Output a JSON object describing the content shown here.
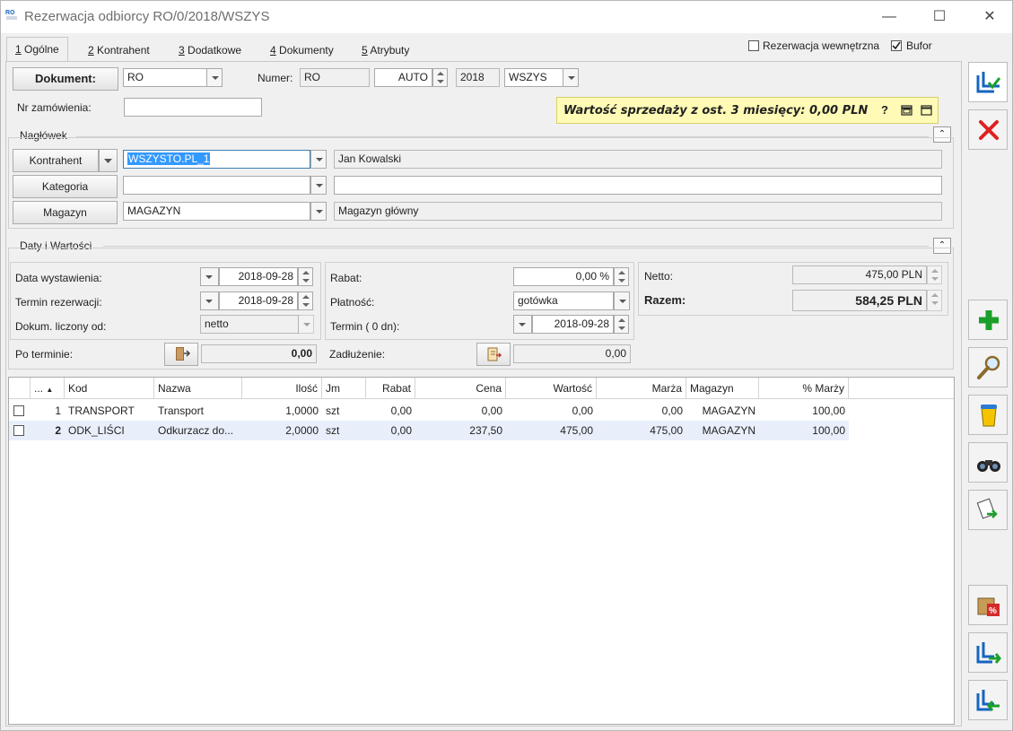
{
  "window": {
    "title": "Rezerwacja odbiorcy RO/0/2018/WSZYS",
    "icon_text": "RO",
    "controls": {
      "minimize": "—",
      "maximize": "☐",
      "close": "✕"
    }
  },
  "tabs": [
    {
      "key": "1",
      "label": " Ogólne"
    },
    {
      "key": "2",
      "label": " Kontrahent"
    },
    {
      "key": "3",
      "label": " Dodatkowe"
    },
    {
      "key": "4",
      "label": " Dokumenty"
    },
    {
      "key": "5",
      "label": " Atrybuty"
    }
  ],
  "top_checks": {
    "internal_label": "Rezerwacja wewnętrzna",
    "internal_checked": false,
    "bufor_label": "Bufor",
    "bufor_checked": true
  },
  "document": {
    "button_label": "Dokument:",
    "type_value": "RO",
    "numer_label": "Numer:",
    "numer_prefix": "RO",
    "numer_auto": "AUTO",
    "numer_year": "2018",
    "numer_series": "WSZYS",
    "order_label": "Nr zamówienia:",
    "order_value": ""
  },
  "sales_info": {
    "text": "Wartość sprzedaży z ost. 3 miesięcy: 0,00 PLN",
    "help": "?"
  },
  "header_group": {
    "title": "Nagłówek",
    "kontrahent_label": "Kontrahent",
    "kontrahent_code": "WSZYSTO.PL_1",
    "kontrahent_name": "Jan Kowalski",
    "kategoria_label": "Kategoria",
    "kategoria_code": "",
    "kategoria_desc": "",
    "magazyn_label": "Magazyn",
    "magazyn_code": "MAGAZYN",
    "magazyn_name": "Magazyn główny"
  },
  "dates_group": {
    "title": "Daty i Wartości",
    "issue_label": "Data wystawienia:",
    "issue_date": "2018-09-28",
    "reservation_label": "Termin rezerwacji:",
    "reservation_date": "2018-09-28",
    "calc_label": "Dokum. liczony od:",
    "calc_value": "netto",
    "overdue_label": "Po terminie:",
    "overdue_value": "0,00",
    "rabat_label": "Rabat:",
    "rabat_value": "0,00 %",
    "payment_label": "Płatność:",
    "payment_value": "gotówka",
    "term_label": "Termin (    0 dn):",
    "term_date": "2018-09-28",
    "debt_label": "Zadłużenie:",
    "debt_value": "0,00",
    "netto_label": "Netto:",
    "netto_value": "475,00 PLN",
    "razem_label": "Razem:",
    "razem_value": "584,25 PLN"
  },
  "table": {
    "columns": [
      "...",
      "Kod",
      "Nazwa",
      "Ilość",
      "Jm",
      "Rabat",
      "Cena",
      "Wartość",
      "Marża",
      "Magazyn",
      "% Marży"
    ],
    "rows": [
      {
        "lp": "1",
        "kod": "TRANSPORT",
        "nazwa": "Transport",
        "ilosc": "1,0000",
        "jm": "szt",
        "rabat": "0,00",
        "cena": "0,00",
        "wartosc": "0,00",
        "marza": "0,00",
        "magazyn": "MAGAZYN",
        "proc_marzy": "100,00"
      },
      {
        "lp": "2",
        "kod": "ODK_LIŚCI",
        "nazwa": "Odkurzacz do...",
        "ilosc": "2,0000",
        "jm": "szt",
        "rabat": "0,00",
        "cena": "237,50",
        "wartosc": "475,00",
        "marza": "475,00",
        "magazyn": "MAGAZYN",
        "proc_marzy": "100,00"
      }
    ]
  },
  "side_toolbar": [
    "save-icon",
    "cancel-icon",
    "add-icon",
    "edit-icon",
    "delete-icon",
    "find-icon",
    "copy-icon",
    "discount-icon",
    "export-icon",
    "import-icon"
  ],
  "colors": {
    "accent": "#1565c0",
    "cancel": "#e02020",
    "add": "#1aa02a",
    "tooltip": "#fffbb6"
  }
}
